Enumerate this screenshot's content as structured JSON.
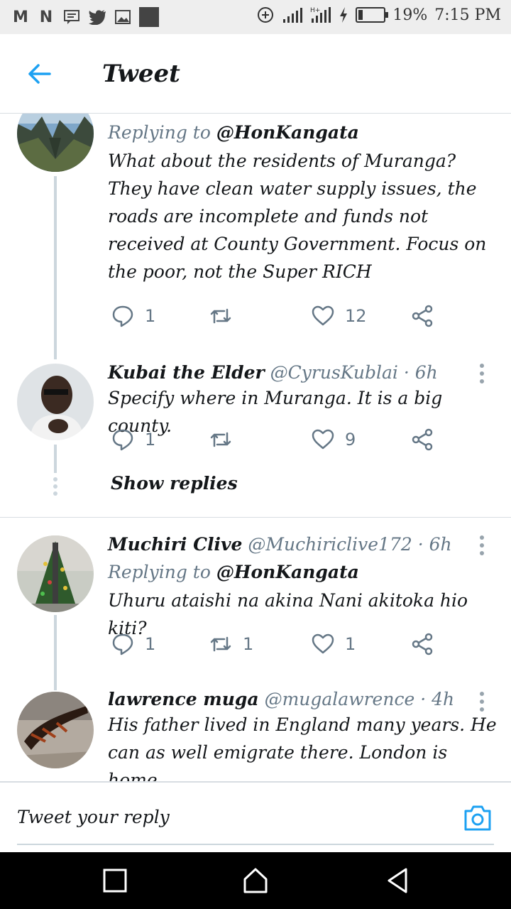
{
  "status_bar": {
    "left_icons": [
      "gmail-icon",
      "news-icon",
      "message-icon",
      "twitter-icon",
      "gallery-icon",
      "app-icon"
    ],
    "right_icons": [
      "data-saver-icon",
      "signal-icon",
      "signal-2g-icon",
      "charging-icon",
      "battery-icon"
    ],
    "battery": "19%",
    "time": "7:15 PM"
  },
  "header": {
    "title": "Tweet"
  },
  "tweets": [
    {
      "replying_label": "Replying to",
      "replying_to": "@HonKangata",
      "text": "What about the residents of Muranga? They have clean water supply issues, the roads are incomplete and funds not received at County Government. Focus on the poor, not the Super RICH",
      "replies": "1",
      "retweets": "",
      "likes": "12"
    },
    {
      "name": "Kubai the Elder",
      "handle": "@CyrusKublai",
      "time": "· 6h",
      "text": "Specify where in Muranga. It is a big county.",
      "replies": "1",
      "retweets": "",
      "likes": "9"
    },
    {
      "name": "Muchiri Clive",
      "handle": "@Muchiriclive172",
      "time": "· 6h",
      "replying_label": "Replying to",
      "replying_to": "@HonKangata",
      "text": "Uhuru ataishi na akina Nani akitoka hio kiti?",
      "replies": "1",
      "retweets": "1",
      "likes": "1"
    },
    {
      "name": "lawrence muga",
      "handle": "@mugalawrence",
      "time": "· 4h",
      "text": "His father lived in England many years. He can as well emigrate there. London is home."
    }
  ],
  "show_replies": "Show replies",
  "composer": {
    "placeholder": "Tweet your reply"
  },
  "colors": {
    "accent": "#1da1f2",
    "muted": "#657786",
    "line": "#ccd6dd"
  }
}
